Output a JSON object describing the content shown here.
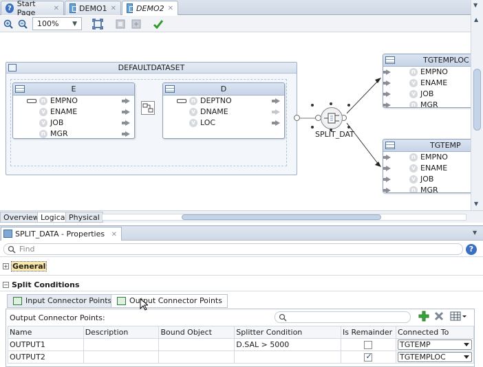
{
  "doc_tabs": [
    {
      "label": "Start Page",
      "active": false
    },
    {
      "label": "DEMO1",
      "active": false
    },
    {
      "label": "DEMO2",
      "active": true
    }
  ],
  "toolbar": {
    "zoom": "100%"
  },
  "canvas": {
    "dataset_title": "DEFAULTDATASET",
    "entity_e": {
      "name": "E",
      "attributes": [
        {
          "name": "EMPNO",
          "key": true,
          "type": "n"
        },
        {
          "name": "ENAME",
          "key": false,
          "type": "v"
        },
        {
          "name": "JOB",
          "key": false,
          "type": "v"
        },
        {
          "name": "MGR",
          "key": false,
          "type": "n"
        }
      ]
    },
    "entity_d": {
      "name": "D",
      "attributes": [
        {
          "name": "DEPTNO",
          "key": true,
          "type": "n"
        },
        {
          "name": "DNAME",
          "key": false,
          "type": "v"
        },
        {
          "name": "LOC",
          "key": false,
          "type": "v"
        }
      ]
    },
    "split_label": "SPLIT_DAT",
    "target_loc": {
      "name": "TGTEMPLOC",
      "attributes": [
        {
          "name": "EMPNO",
          "type": "n"
        },
        {
          "name": "ENAME",
          "type": "v"
        },
        {
          "name": "JOB",
          "type": "v"
        },
        {
          "name": "MGR",
          "type": "n"
        }
      ]
    },
    "target_emp": {
      "name": "TGTEMP",
      "attributes": [
        {
          "name": "EMPNO",
          "type": "n"
        },
        {
          "name": "ENAME",
          "type": "v"
        },
        {
          "name": "JOB",
          "type": "v"
        },
        {
          "name": "MGR",
          "type": "n"
        }
      ]
    }
  },
  "view_tabs": [
    {
      "label": "Overview",
      "active": false
    },
    {
      "label": "Logical",
      "active": true
    },
    {
      "label": "Physical",
      "active": false
    }
  ],
  "properties": {
    "title": "SPLIT_DATA - Properties",
    "find_placeholder": "Find",
    "general_label": "General",
    "split_conditions_label": "Split Conditions",
    "connector_tabs": [
      {
        "label": "Input Connector Points",
        "active": false
      },
      {
        "label": "Output Connector Points",
        "active": true
      }
    ],
    "output_label": "Output Connector Points:",
    "columns": [
      "Name",
      "Description",
      "Bound Object",
      "Splitter Condition",
      "Is Remainder",
      "Connected To"
    ],
    "rows": [
      {
        "name": "OUTPUT1",
        "description": "",
        "bound_object": "",
        "condition": "D.SAL > 5000",
        "is_remainder": false,
        "connected_to": "TGTEMP"
      },
      {
        "name": "OUTPUT2",
        "description": "",
        "bound_object": "",
        "condition": "",
        "is_remainder": true,
        "connected_to": "TGTEMPLOC"
      }
    ]
  }
}
